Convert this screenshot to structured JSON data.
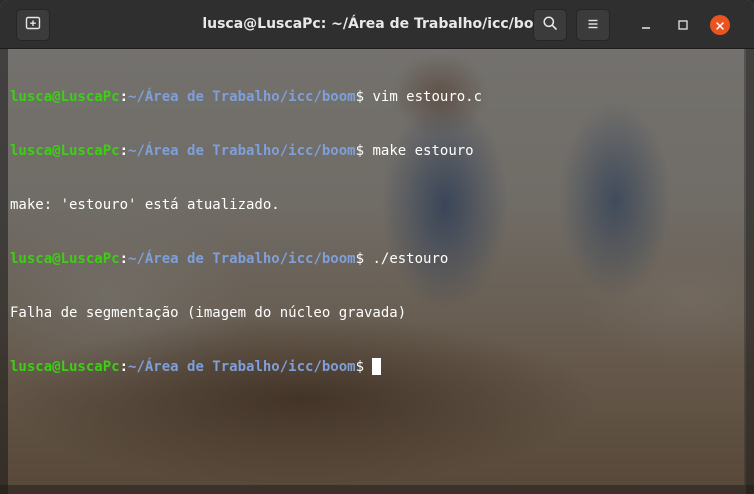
{
  "window": {
    "title": "lusca@LuscaPc: ~/Área de Trabalho/icc/boom"
  },
  "headerbar": {
    "new_tab_icon": "new-tab-icon",
    "search_icon": "search-icon",
    "menu_icon": "hamburger-menu-icon",
    "minimize_icon": "minimize-icon",
    "maximize_icon": "maximize-icon",
    "close_icon": "close-icon",
    "close_color": "#e95420"
  },
  "terminal": {
    "colors": {
      "user_host": "#3bd012",
      "path": "#7f9fd9",
      "text": "#ffffff"
    },
    "lines": [
      {
        "type": "prompt",
        "user_host": "lusca@LuscaPc",
        "colon": ":",
        "path": "~/Área de Trabalho/icc/boom",
        "dollar": "$",
        "command": " vim estouro.c"
      },
      {
        "type": "prompt",
        "user_host": "lusca@LuscaPc",
        "colon": ":",
        "path": "~/Área de Trabalho/icc/boom",
        "dollar": "$",
        "command": " make estouro"
      },
      {
        "type": "output",
        "text": "make: 'estouro' está atualizado."
      },
      {
        "type": "prompt",
        "user_host": "lusca@LuscaPc",
        "colon": ":",
        "path": "~/Área de Trabalho/icc/boom",
        "dollar": "$",
        "command": " ./estouro"
      },
      {
        "type": "output",
        "text": "Falha de segmentação (imagem do núcleo gravada)"
      },
      {
        "type": "prompt",
        "user_host": "lusca@LuscaPc",
        "colon": ":",
        "path": "~/Área de Trabalho/icc/boom",
        "dollar": "$",
        "command": " "
      }
    ]
  }
}
